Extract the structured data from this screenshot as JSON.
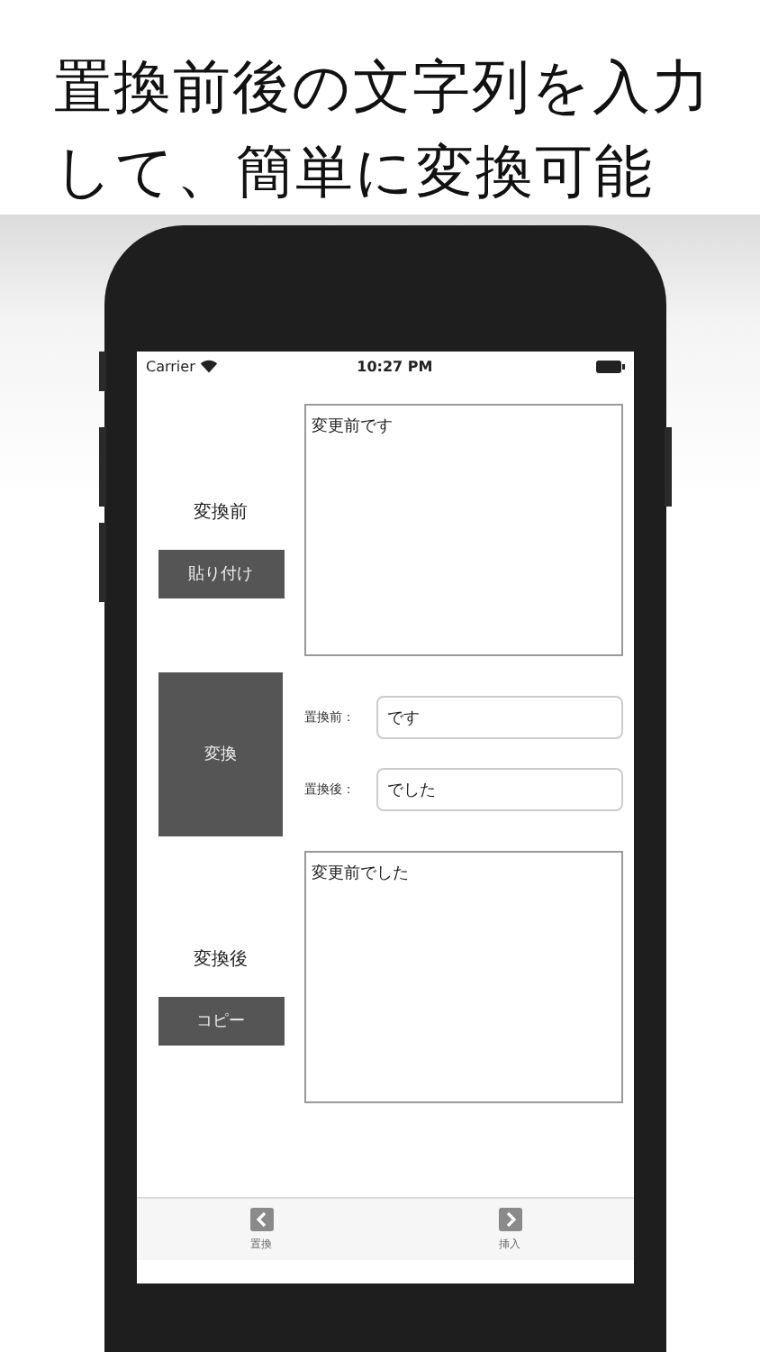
{
  "headline": "置換前後の文字列を入力して、簡単に変換可能",
  "status_bar": {
    "carrier": "Carrier",
    "time": "10:27 PM"
  },
  "source": {
    "label": "変換前",
    "paste_button": "貼り付け",
    "text": "変更前です"
  },
  "convert_button": "変換",
  "fields": [
    {
      "label": "置換前：",
      "value": "です"
    },
    {
      "label": "置換後：",
      "value": "でした"
    }
  ],
  "result": {
    "label": "変換後",
    "copy_button": "コピー",
    "text": "変更前でした"
  },
  "tabs": [
    {
      "label": "置換",
      "kind": "back"
    },
    {
      "label": "挿入",
      "kind": "forward"
    }
  ]
}
